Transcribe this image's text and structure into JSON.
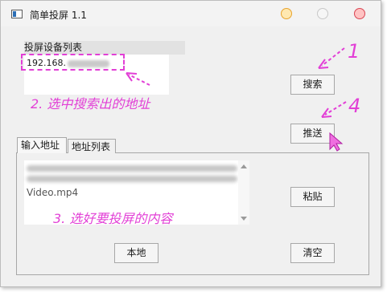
{
  "window": {
    "title": "简单投屏 1.1"
  },
  "device_section": {
    "label": "投屏设备列表",
    "items": [
      {
        "ip_visible": "192.168."
      }
    ]
  },
  "buttons": {
    "search": "搜索",
    "push": "推送",
    "paste": "粘贴",
    "local": "本地",
    "clear": "清空"
  },
  "tabs": [
    {
      "label": "输入地址"
    },
    {
      "label": "地址列表"
    }
  ],
  "input_area": {
    "file_name": "Video.mp4"
  },
  "annotations": {
    "step1": "1",
    "step2": "2. 选中搜索出的地址",
    "step3": "3. 选好要投屏的内容",
    "step4": "4"
  },
  "colors": {
    "annotation": "#e23fd6",
    "window_bg": "#f0f0f0"
  }
}
